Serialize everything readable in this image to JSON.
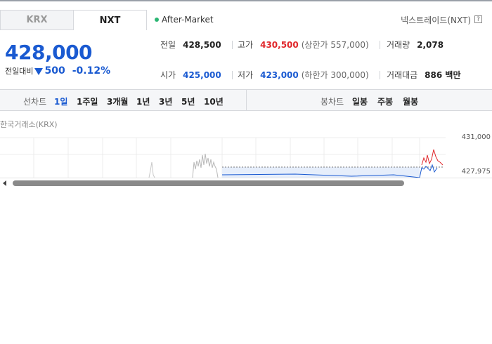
{
  "tabs": [
    {
      "label": "KRX"
    },
    {
      "label": "NXT"
    }
  ],
  "market_status": "After-Market",
  "exchange_name": "넥스트레이드(NXT)",
  "help_label": "?",
  "price": {
    "current": "428,000",
    "change_label": "전일대비",
    "change_amount": "500",
    "change_pct": "-0.12%",
    "direction": "down"
  },
  "stats": {
    "prev_close": {
      "label": "전일",
      "value": "428,500"
    },
    "high": {
      "label": "고가",
      "value": "430,500",
      "sub": "(상한가 557,000)"
    },
    "volume": {
      "label": "거래량",
      "value": "2,078"
    },
    "open": {
      "label": "시가",
      "value": "425,000"
    },
    "low": {
      "label": "저가",
      "value": "423,000",
      "sub": "(하한가 300,000)"
    },
    "trade_value": {
      "label": "거래대금",
      "value": "886 백만"
    }
  },
  "period_bar": {
    "line_label": "선차트",
    "line_periods": [
      "1일",
      "1주일",
      "3개월",
      "1년",
      "3년",
      "5년",
      "10년"
    ],
    "active_period": "1일",
    "candle_label": "봉차트",
    "candle_periods": [
      "일봉",
      "주봉",
      "월봉"
    ]
  },
  "chart": {
    "source_label": "한국거래소(KRX)",
    "y_top_label": "431,000",
    "y_bottom_label": "427,975"
  },
  "colors": {
    "up": "#e0262a",
    "down": "#1a5ad1",
    "status_dot": "#2bb673"
  }
}
